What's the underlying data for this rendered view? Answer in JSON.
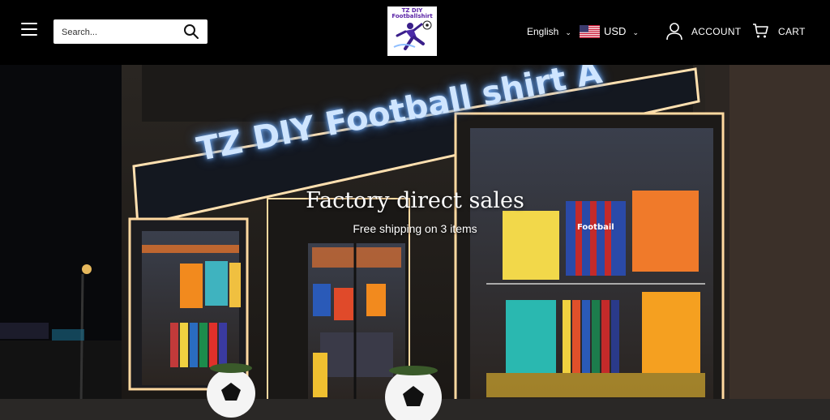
{
  "header": {
    "menu_icon": "hamburger-icon",
    "search": {
      "placeholder": "Search...",
      "icon": "search-icon"
    },
    "logo": {
      "text": "TZ DIY Footballshirt"
    },
    "language": {
      "label": "English",
      "icon": "chevron-down-icon"
    },
    "currency": {
      "label": "USD",
      "flag": "us-flag-icon",
      "icon": "chevron-down-icon"
    },
    "account_label": "ACCOUNT",
    "cart_label": "CART"
  },
  "hero": {
    "sign_text": "TZ DIY Football shirt A",
    "title": "Factory direct sales",
    "subtitle": "Free shipping on 3 items",
    "shirt_text": "Footbail"
  },
  "colors": {
    "header_bg": "#000000",
    "sign_glow": "#7fb8ff",
    "frame_light": "#ffd9a0"
  }
}
